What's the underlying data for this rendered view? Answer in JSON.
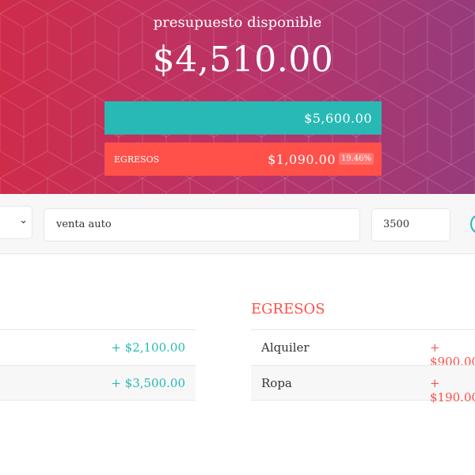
{
  "header": {
    "title": "presupuesto disponible",
    "available": "$4,510.00",
    "income_total": "$5,600.00",
    "expense_label": "Egresos",
    "expense_total": "$1,090.00",
    "expense_percentage": "19.46%"
  },
  "add_form": {
    "type_select": "",
    "description_value": "venta auto",
    "amount_value": "3500"
  },
  "income": {
    "items": [
      {
        "description": "",
        "value": "+ $2,100.00"
      },
      {
        "description": "",
        "value": "+ $3,500.00"
      }
    ]
  },
  "expenses": {
    "heading": "Egresos",
    "items": [
      {
        "description": "Alquiler",
        "value": "+ $900.00"
      },
      {
        "description": "Ropa",
        "value": "+ $190.00"
      }
    ]
  },
  "colors": {
    "income": "#28b9b5",
    "expense": "#ff5049",
    "gradient_start": "#cf2c4a",
    "gradient_end": "#963b7b"
  }
}
